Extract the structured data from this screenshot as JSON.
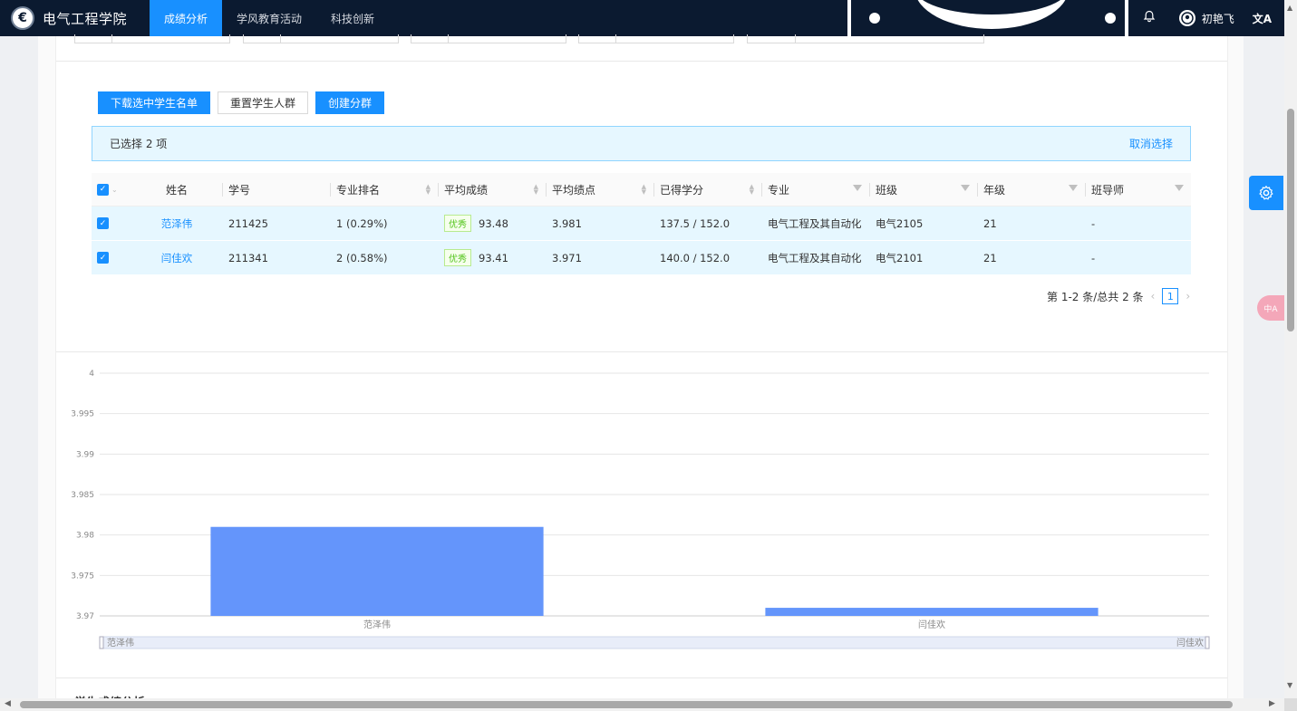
{
  "nav": {
    "logo_mark": "€",
    "title": "电气工程学院",
    "tabs": [
      {
        "label": "成绩分析",
        "active": true
      },
      {
        "label": "学风教育活动",
        "active": false
      },
      {
        "label": "科技创新",
        "active": false
      }
    ],
    "user_name": "初艳飞",
    "bell_icon": "🔔",
    "lang_icon": "文A"
  },
  "toolbar": {
    "download_label": "下载选中学生名单",
    "reset_label": "重置学生人群",
    "create_label": "创建分群"
  },
  "alert": {
    "selected_text": "已选择  2  项",
    "cancel_label": "取消选择"
  },
  "table": {
    "headers": {
      "name": "姓名",
      "id": "学号",
      "rank": "专业排名",
      "avg": "平均成绩",
      "gpa": "平均绩点",
      "credit": "已得学分",
      "major": "专业",
      "class": "班级",
      "grade": "年级",
      "advisor": "班导师"
    },
    "rows": [
      {
        "name": "范泽伟",
        "id": "211425",
        "rank": "1 (0.29%)",
        "tag": "优秀",
        "avg": "93.48",
        "gpa": "3.981",
        "credit": "137.5 / 152.0",
        "major": "电气工程及其自动化",
        "class": "电气2105",
        "grade": "21",
        "advisor": "-"
      },
      {
        "name": "闫佳欢",
        "id": "211341",
        "rank": "2 (0.58%)",
        "tag": "优秀",
        "avg": "93.41",
        "gpa": "3.971",
        "credit": "140.0 / 152.0",
        "major": "电气工程及其自动化",
        "class": "电气2101",
        "grade": "21",
        "advisor": "-"
      }
    ]
  },
  "pagination": {
    "summary": "第 1-2 条/总共 2 条",
    "current_page": "1"
  },
  "chart_data": {
    "type": "bar",
    "categories": [
      "范泽伟",
      "闫佳欢"
    ],
    "values": [
      3.981,
      3.971
    ],
    "ylim": [
      3.97,
      4
    ],
    "yticks": [
      "4",
      "3.995",
      "3.99",
      "3.985",
      "3.98",
      "3.975",
      "3.97"
    ],
    "grid": true,
    "bar_color": "#6495fb",
    "datazoom": {
      "start_label": "范泽伟",
      "end_label": "闫佳欢"
    }
  },
  "next_section_title": "学生成绩分析",
  "colors": {
    "primary": "#1890ff",
    "nav_bg": "#0b1a30",
    "alert_bg": "#e6f7ff",
    "tag_green": "#52c41a"
  }
}
